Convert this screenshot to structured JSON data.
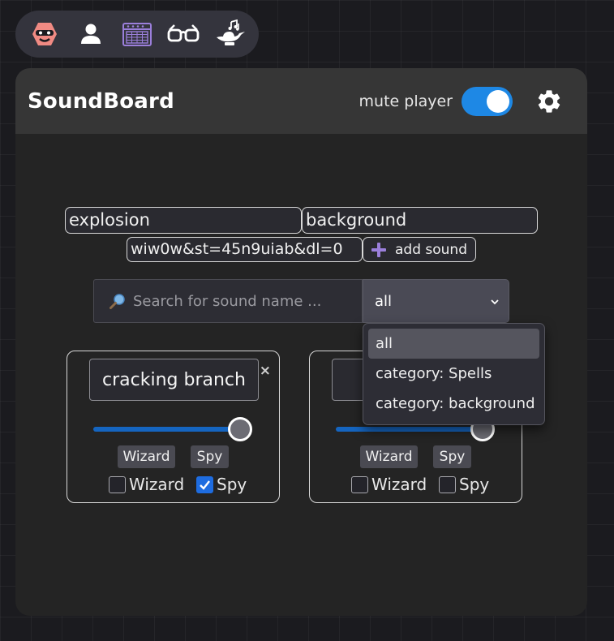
{
  "toolbar": {
    "icons": [
      "hero-mask-icon",
      "user-icon",
      "amplifier-icon",
      "glasses-icon",
      "magic-lamp-icon"
    ],
    "accent": "#9b7fdb"
  },
  "panel": {
    "title": "SoundBoard",
    "mute_label": "mute player",
    "mute_on": true
  },
  "add_sound": {
    "name_value": "explosion",
    "category_value": "background",
    "url_value": "wiw0w&st=45n9uiab&dl=0",
    "button_label": "add sound"
  },
  "search": {
    "placeholder": "Search for sound name ..."
  },
  "filter": {
    "selected": "all",
    "options": [
      "all",
      "category: Spells",
      "category: background"
    ]
  },
  "cards": [
    {
      "name": "cracking branch",
      "close": "×",
      "volume": 1.0,
      "chips": [
        "Wizard",
        "Spy"
      ],
      "checks": [
        {
          "label": "Wizard",
          "checked": false
        },
        {
          "label": "Spy",
          "checked": true
        }
      ]
    },
    {
      "name": "",
      "volume": 1.0,
      "chips": [
        "Wizard",
        "Spy"
      ],
      "checks": [
        {
          "label": "Wizard",
          "checked": false
        },
        {
          "label": "Spy",
          "checked": false
        }
      ]
    }
  ]
}
